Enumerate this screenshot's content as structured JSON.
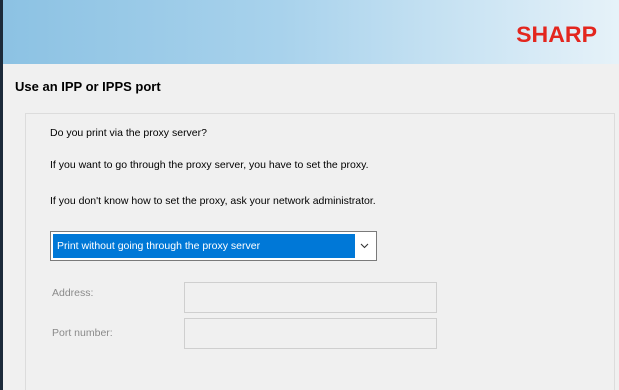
{
  "brand": {
    "logo_text": "SHARP",
    "logo_color": "#e3261e",
    "banner_gradient": [
      "#8cc2e3",
      "#e6f2f9"
    ]
  },
  "page": {
    "title": "Use an IPP or IPPS port"
  },
  "content": {
    "question": "Do you print via the proxy server?",
    "info_line_1": "If you want to go through the proxy server, you have to set the proxy.",
    "info_line_2": "If you don't know how to set the proxy, ask your network administrator."
  },
  "proxy_select": {
    "selected": "Print without going through the proxy server",
    "selected_bg": "#0078d7"
  },
  "fields": {
    "address_label": "Address:",
    "address_value": "",
    "port_label": "Port number:",
    "port_value": ""
  }
}
